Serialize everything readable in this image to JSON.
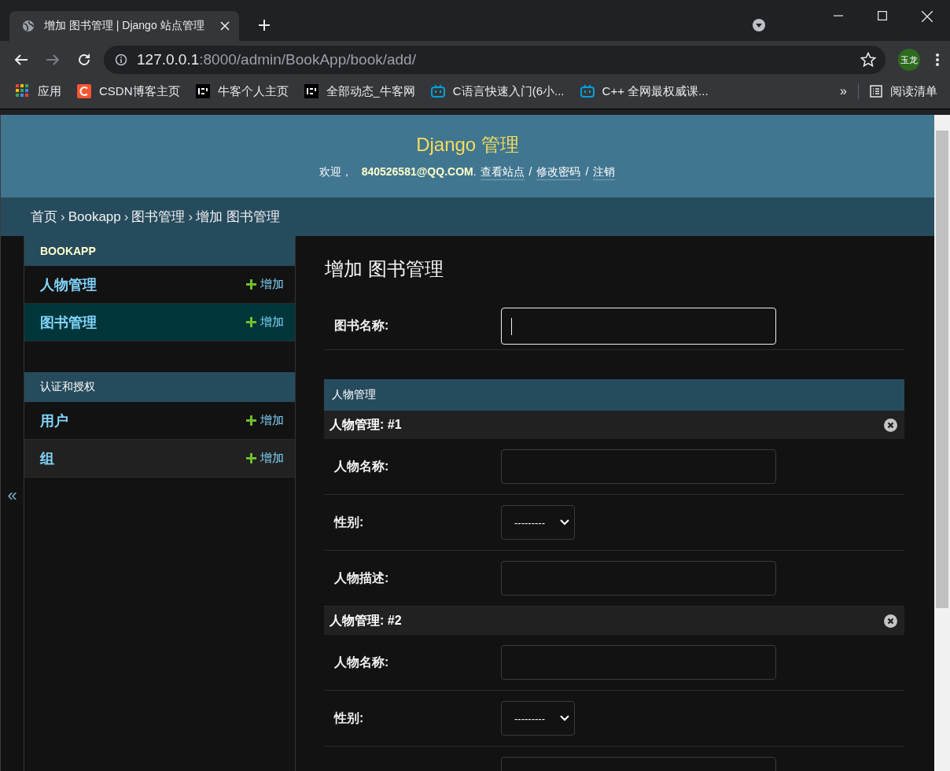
{
  "browser": {
    "tab_title": "增加 图书管理 | Django 站点管理",
    "url_host": "127.0.0.1",
    "url_path": ":8000/admin/BookApp/book/add/",
    "profile": "玉龙",
    "bookmarks": [
      {
        "label": "应用",
        "kind": "apps"
      },
      {
        "label": "CSDN博客主页",
        "kind": "csdn"
      },
      {
        "label": "牛客个人主页",
        "kind": "nowcoder"
      },
      {
        "label": "全部动态_牛客网",
        "kind": "nowcoder"
      },
      {
        "label": "C语言快速入门(6小...",
        "kind": "bilibili"
      },
      {
        "label": "C++ 全网最权威课...",
        "kind": "bilibili"
      }
    ],
    "more": "»",
    "reading_list": "阅读清单"
  },
  "header": {
    "title": "Django 管理",
    "welcome": "欢迎，",
    "user": "840526581@QQ.COM",
    "user_suffix": ".",
    "separator": "/",
    "links": [
      "查看站点",
      "修改密码",
      "注销"
    ]
  },
  "breadcrumbs": {
    "separator": "›",
    "items": [
      "首页",
      "Bookapp",
      "图书管理",
      "增加 图书管理"
    ]
  },
  "nav_toggle": "«",
  "sidebar": {
    "apps": [
      {
        "name": "BOOKAPP",
        "current": true,
        "models": [
          {
            "name": "人物管理",
            "add": "增加",
            "selected": false
          },
          {
            "name": "图书管理",
            "add": "增加",
            "selected": true
          }
        ]
      },
      {
        "name": "认证和授权",
        "current": false,
        "models": [
          {
            "name": "用户",
            "add": "增加",
            "selected": false
          },
          {
            "name": "组",
            "add": "增加",
            "selected": false
          }
        ]
      }
    ]
  },
  "content": {
    "title": "增加 图书管理",
    "main_fields": [
      {
        "label": "图书名称:",
        "kind": "text",
        "focused": true
      }
    ],
    "inline": {
      "title": "人物管理",
      "items": [
        {
          "title": "人物管理: #1",
          "fields": [
            {
              "label": "人物名称:",
              "kind": "text"
            },
            {
              "label": "性别:",
              "kind": "select",
              "value": "---------"
            },
            {
              "label": "人物描述:",
              "kind": "text"
            }
          ]
        },
        {
          "title": "人物管理: #2",
          "fields": [
            {
              "label": "人物名称:",
              "kind": "text"
            },
            {
              "label": "性别:",
              "kind": "select",
              "value": "---------"
            },
            {
              "kind": "text"
            }
          ]
        }
      ]
    }
  }
}
